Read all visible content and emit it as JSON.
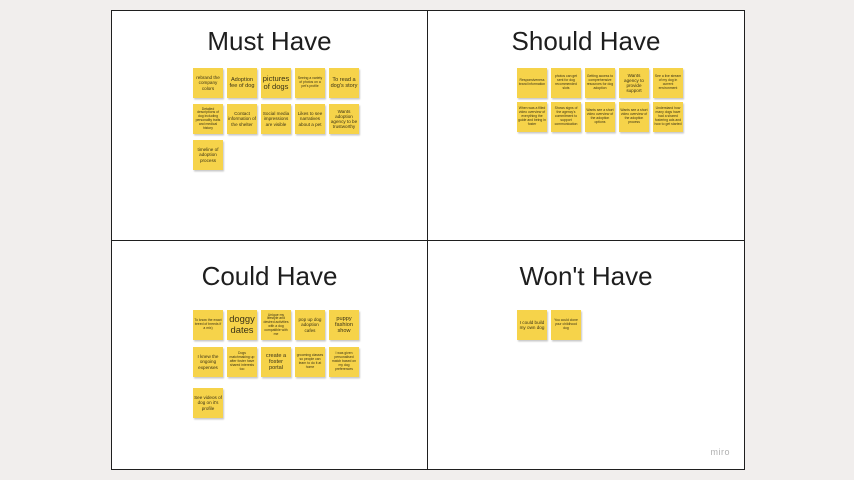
{
  "board": {
    "watermark": "miro",
    "quadrants": {
      "must": {
        "title": "Must Have",
        "notes": [
          "rebrand the company colors",
          "Adoption fee of dog",
          "pictures of dogs",
          "Seeing a variety of photos on a pet's profile",
          "To read a dog's story",
          "Detailed descriptions of dog including personality traits and medical history",
          "Contact information of the shelter",
          "Social media impressions are visible",
          "Likes to see narratives about a pet",
          "Wants adoption agency to be trustworthy",
          "timeline of adoption process"
        ]
      },
      "should": {
        "title": "Should Have",
        "notes": [
          "Responsiveness brand information",
          "photos can get sent for dog recommended slots",
          "Getting access to comprehensive resources for dog adoption",
          "Wants agency to provide support",
          "See a live stream of my dog in current environment",
          "When was a filled video overview of everything the guide and being in foster",
          "Shows signs of the agency's commitment to support communication",
          "Wants see a short video overview of the adoption options",
          "Wants see a short video overview of the adoption process",
          "Understand how many dogs have had a shared fostering ads and how to get started"
        ]
      },
      "could": {
        "title": "Could Have",
        "notes": [
          "To know the exact breed of breeds if a mix)",
          "doggy dates",
          "Unique my lifestyle and desired activities with a dog compatible with me",
          "pop up dog adoption cafes",
          "puppy fashion show",
          "I knew the ongoing expenses",
          "Dogs matchmaking up after foster have shared interests too",
          "create a foster portal",
          "grooming classes so people can learn to do it at home",
          "I was given personalised match based on my dog preferences",
          "See videos of dog on it's profile"
        ]
      },
      "wont": {
        "title": "Won't Have",
        "notes": [
          "I could build my own dog",
          "You could clone your childhood dog"
        ]
      }
    }
  }
}
